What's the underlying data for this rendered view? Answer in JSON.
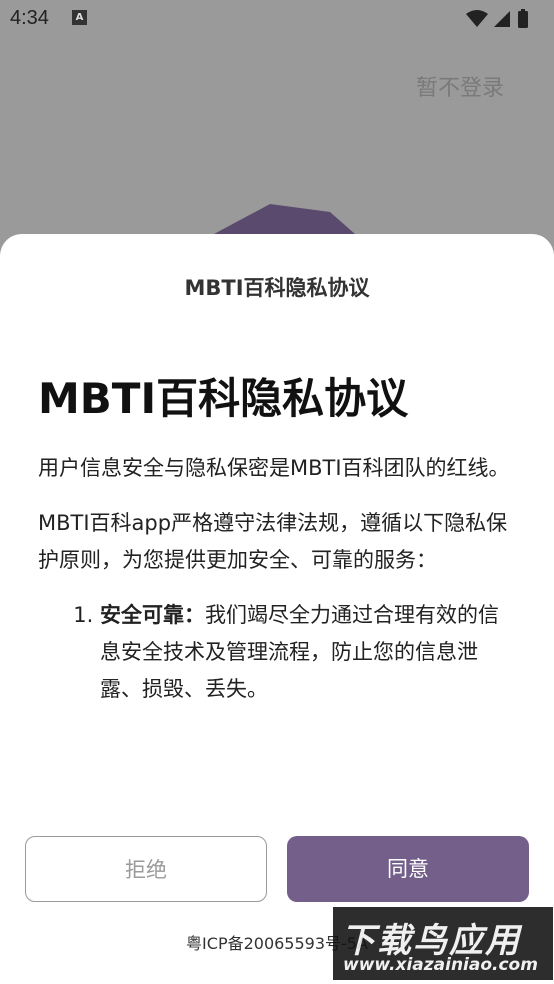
{
  "status_bar": {
    "time": "4:34",
    "notification_icon": "A"
  },
  "skip_login": "暂不登录",
  "dialog": {
    "title": "MBTI百科隐私协议",
    "heading": "MBTI百科隐私协议",
    "paragraph_1": "用户信息安全与隐私保密是MBTI百科团队的红线。",
    "paragraph_2": "MBTI百科app严格遵守法律法规，遵循以下隐私保护原则，为您提供更加安全、可靠的服务：",
    "list_items": [
      {
        "bold": "安全可靠：",
        "text": "我们竭尽全力通过合理有效的信息安全技术及管理流程，防止您的信息泄露、损毁、丢失。"
      }
    ],
    "reject_label": "拒绝",
    "agree_label": "同意",
    "icp": "粤ICP备20065593号-5A"
  },
  "watermark": {
    "title": "下载鸟应用",
    "url": "www.xiazainiao.com"
  },
  "colors": {
    "accent": "#735f8a",
    "overlay": "#9a9a9a"
  }
}
